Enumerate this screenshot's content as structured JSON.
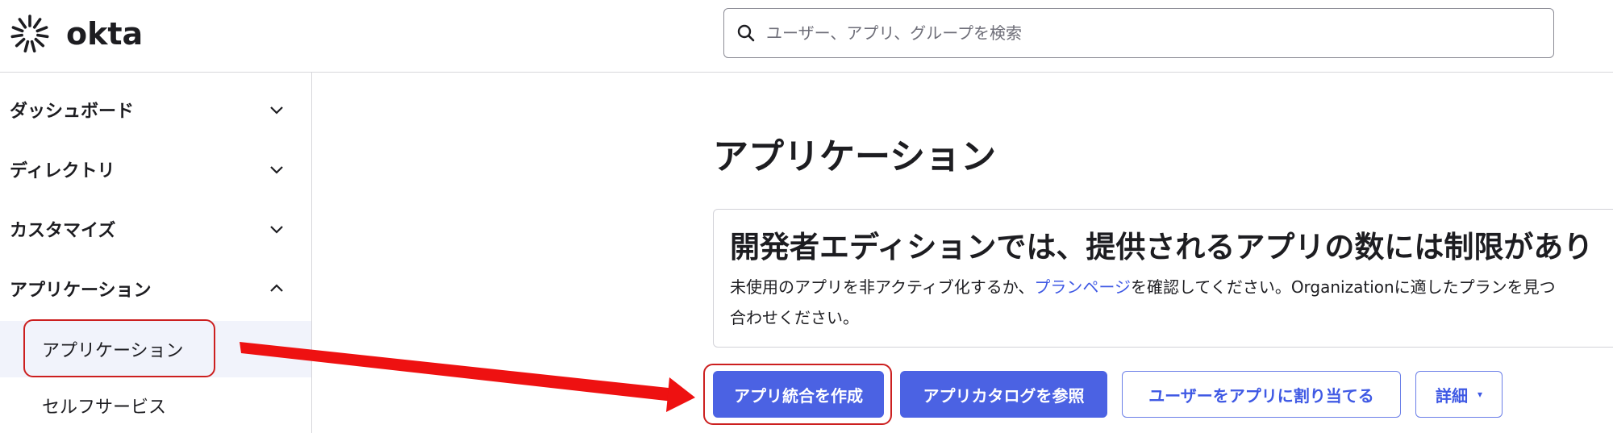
{
  "header": {
    "logo_text": "okta",
    "search": {
      "placeholder": "ユーザー、アプリ、グループを検索",
      "value": ""
    }
  },
  "sidebar": {
    "items": [
      {
        "label": "ダッシュボード",
        "expanded": false,
        "icon": "chevron-down-icon"
      },
      {
        "label": "ディレクトリ",
        "expanded": false,
        "icon": "chevron-down-icon"
      },
      {
        "label": "カスタマイズ",
        "expanded": false,
        "icon": "chevron-down-icon"
      },
      {
        "label": "アプリケーション",
        "expanded": true,
        "icon": "chevron-up-icon"
      }
    ],
    "subitems": [
      {
        "label": "アプリケーション",
        "active": true
      },
      {
        "label": "セルフサービス",
        "active": false
      }
    ]
  },
  "main": {
    "title": "アプリケーション",
    "banner": {
      "heading": "開発者エディションでは、提供されるアプリの数には制限があり",
      "body_prefix": "未使用のアプリを非アクティブ化するか、",
      "body_link": "プランページ",
      "body_suffix": "を確認してください。Organizationに適したプランを見つ",
      "body_line2": "合わせください。"
    },
    "buttons": {
      "create": "アプリ統合を作成",
      "browse": "アプリカタログを参照",
      "assign": "ユーザーをアプリに割り当てる",
      "more": "詳細",
      "more_caret": "▾"
    }
  },
  "colors": {
    "primary": "#4b62e3",
    "link": "#3f59e4",
    "annotation_red": "#ee1111",
    "active_bg": "#f1f3fb"
  }
}
